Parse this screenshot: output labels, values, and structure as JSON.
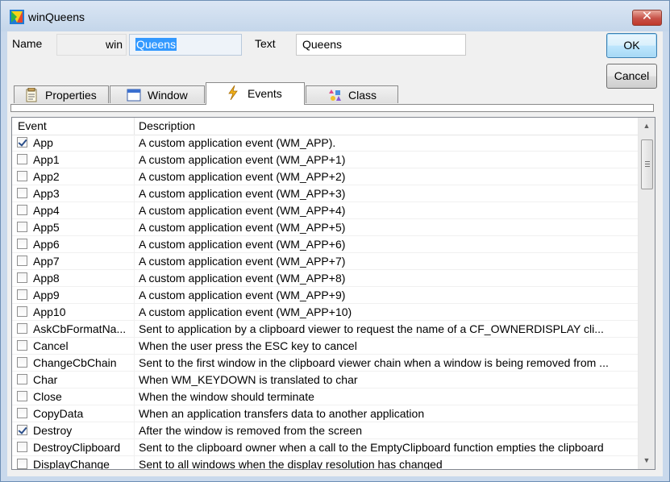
{
  "window": {
    "title": "winQueens",
    "app_icon": "app-icon",
    "close_glyph": "✕"
  },
  "form": {
    "name_label": "Name",
    "name_prefix": "win",
    "name_value": "Queens",
    "text_label": "Text",
    "text_value": "Queens",
    "ok_label": "OK",
    "cancel_label": "Cancel"
  },
  "tabs": [
    {
      "label": "Properties",
      "icon": "properties-icon",
      "active": false
    },
    {
      "label": "Window",
      "icon": "window-icon",
      "active": false
    },
    {
      "label": "Events",
      "icon": "lightning-icon",
      "active": true
    },
    {
      "label": "Class",
      "icon": "class-icon",
      "active": false
    }
  ],
  "grid": {
    "columns": [
      "Event",
      "Description"
    ],
    "rows": [
      {
        "event": "App",
        "description": "A custom application event (WM_APP).",
        "checked": true
      },
      {
        "event": "App1",
        "description": "A custom application event (WM_APP+1)",
        "checked": false
      },
      {
        "event": "App2",
        "description": "A custom application event (WM_APP+2)",
        "checked": false
      },
      {
        "event": "App3",
        "description": "A custom application event (WM_APP+3)",
        "checked": false
      },
      {
        "event": "App4",
        "description": "A custom application event (WM_APP+4)",
        "checked": false
      },
      {
        "event": "App5",
        "description": "A custom application event (WM_APP+5)",
        "checked": false
      },
      {
        "event": "App6",
        "description": "A custom application event (WM_APP+6)",
        "checked": false
      },
      {
        "event": "App7",
        "description": "A custom application event (WM_APP+7)",
        "checked": false
      },
      {
        "event": "App8",
        "description": "A custom application event (WM_APP+8)",
        "checked": false
      },
      {
        "event": "App9",
        "description": "A custom application event (WM_APP+9)",
        "checked": false
      },
      {
        "event": "App10",
        "description": "A custom application event (WM_APP+10)",
        "checked": false
      },
      {
        "event": "AskCbFormatNa...",
        "description": "Sent to application by a clipboard viewer to request the name of a CF_OWNERDISPLAY cli...",
        "checked": false
      },
      {
        "event": "Cancel",
        "description": "When the user press the ESC key to cancel",
        "checked": false
      },
      {
        "event": "ChangeCbChain",
        "description": "Sent to the first window in the clipboard viewer chain when a window is being removed from ...",
        "checked": false
      },
      {
        "event": "Char",
        "description": "When WM_KEYDOWN is translated to char",
        "checked": false
      },
      {
        "event": "Close",
        "description": "When the window should terminate",
        "checked": false
      },
      {
        "event": "CopyData",
        "description": "When an application transfers data to another application",
        "checked": false
      },
      {
        "event": "Destroy",
        "description": "After the window is removed from the screen",
        "checked": true
      },
      {
        "event": "DestroyClipboard",
        "description": "Sent to the clipboard owner when a call to the EmptyClipboard function empties the clipboard",
        "checked": false
      },
      {
        "event": "DisplayChange",
        "description": "Sent to all windows when the display resolution has changed",
        "checked": false
      }
    ]
  },
  "scrollbar": {
    "up_glyph": "▲",
    "down_glyph": "▼"
  },
  "colors": {
    "selection": "#3399ff",
    "close_button": "#c75248",
    "titlebar": "#c4d6ea"
  }
}
